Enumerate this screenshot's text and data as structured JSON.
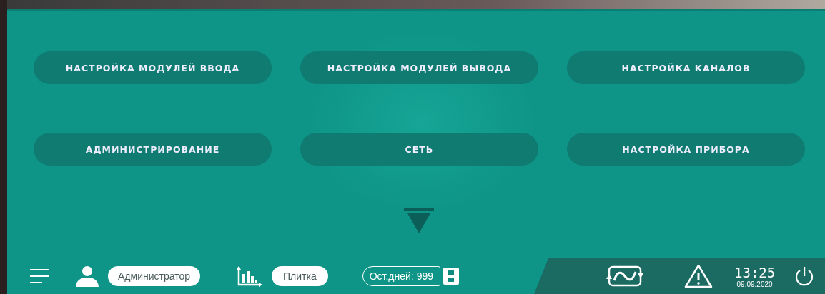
{
  "menu_buttons": [
    {
      "label": "НАСТРОЙКА МОДУЛЕЙ ВВОДА"
    },
    {
      "label": "НАСТРОЙКА МОДУЛЕЙ ВЫВОДА"
    },
    {
      "label": "НАСТРОЙКА КАНАЛОВ"
    },
    {
      "label": "АДМИНИСТРИРОВАНИЕ"
    },
    {
      "label": "СЕТЬ"
    },
    {
      "label": "НАСТРОЙКА ПРИБОРА"
    }
  ],
  "status_bar": {
    "user": "Администратор",
    "view_mode": "Плитка",
    "days_left": "Ост.дней: 999",
    "time": "13:25",
    "date": "09.09.2020"
  }
}
